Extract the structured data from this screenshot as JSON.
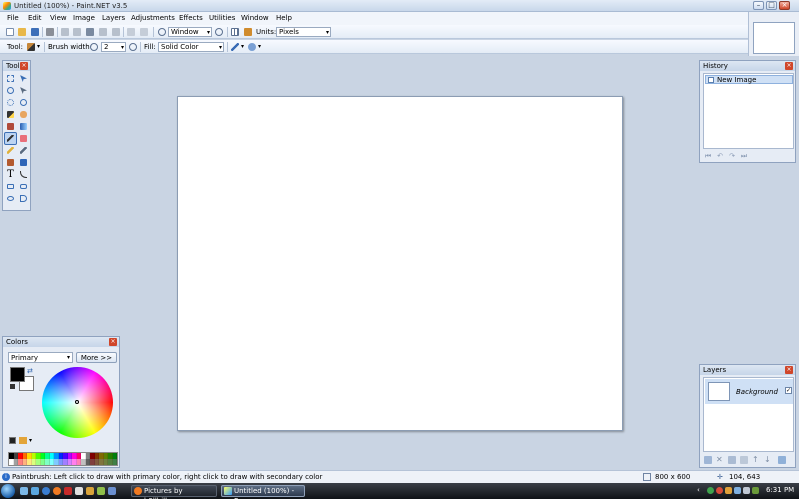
{
  "window": {
    "title": "Untitled (100%) - Paint.NET v3.5"
  },
  "menu": [
    "File",
    "Edit",
    "View",
    "Image",
    "Layers",
    "Adjustments",
    "Effects",
    "Utilities",
    "Window",
    "Help"
  ],
  "toolbar": {
    "zoom_value": "Window",
    "units_label": "Units:",
    "units_value": "Pixels",
    "tool_label": "Tool:",
    "brush_width_label": "Brush width:",
    "brush_width_value": "2",
    "fill_label": "Fill:",
    "fill_value": "Solid Color"
  },
  "panels": {
    "tools_title": "Tools",
    "history_title": "History",
    "history_items": [
      "New Image"
    ],
    "colors_title": "Colors",
    "colors_mode": "Primary",
    "more_button": "More >>",
    "layers_title": "Layers",
    "layers": [
      {
        "name": "Background",
        "visible": true
      }
    ]
  },
  "colors": {
    "primary": "#000000",
    "secondary": "#ffffff",
    "palette": [
      "#000000",
      "#404040",
      "#ff0000",
      "#ff6a00",
      "#ffd800",
      "#b6ff00",
      "#4cff00",
      "#00ff21",
      "#00ff90",
      "#00ffff",
      "#0094ff",
      "#0026ff",
      "#4800ff",
      "#b200ff",
      "#ff00dc",
      "#ff006e",
      "#ffffff",
      "#808080",
      "#7f0000",
      "#7f3300",
      "#7f6a00",
      "#5b7f00",
      "#267f00",
      "#007f0e",
      "#ffffff",
      "#a0a0a0",
      "#ff7f7f",
      "#ffb27f",
      "#ffe97f",
      "#daff7f",
      "#a5ff7f",
      "#7fff8e",
      "#7fffc5",
      "#7fffff",
      "#7fc9ff",
      "#7f92ff",
      "#a17fff",
      "#d67fff",
      "#ff7fed",
      "#ff7fb6",
      "#c0c0c0",
      "#606060",
      "#7f3f3f",
      "#7f593f",
      "#7f743f",
      "#6d7f3f",
      "#527f3f",
      "#3f7f47"
    ]
  },
  "status": {
    "message": "Paintbrush: Left click to draw with primary color, right click to draw with secondary color",
    "image_size": "800 x 600",
    "cursor_pos": "104, 643"
  },
  "taskbar": {
    "items": [
      "Pictures by h3llbillyn...",
      "Untitled (100%) - Pa..."
    ],
    "clock": "6:31 PM"
  }
}
